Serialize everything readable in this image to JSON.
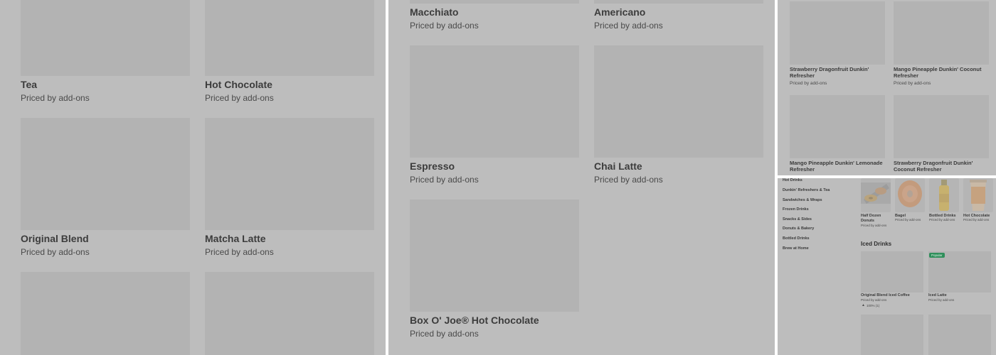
{
  "panel_a": {
    "items": [
      {
        "name": "Tea",
        "price": "Priced by add-ons"
      },
      {
        "name": "Hot Chocolate",
        "price": "Priced by add-ons"
      },
      {
        "name": "Original Blend",
        "price": "Priced by add-ons"
      },
      {
        "name": "Matcha Latte",
        "price": "Priced by add-ons"
      }
    ]
  },
  "panel_b": {
    "items": [
      {
        "name": "Macchiato",
        "price": "Priced by add-ons"
      },
      {
        "name": "Americano",
        "price": "Priced by add-ons"
      },
      {
        "name": "Espresso",
        "price": "Priced by add-ons"
      },
      {
        "name": "Chai Latte",
        "price": "Priced by add-ons"
      },
      {
        "name": "Box O' Joe® Hot Chocolate",
        "price": "Priced by add-ons"
      }
    ]
  },
  "panel_c": {
    "items": [
      {
        "name": "Strawberry Dragonfruit Dunkin' Refresher",
        "price": "Priced by add-ons"
      },
      {
        "name": "Mango Pineapple Dunkin' Coconut Refresher",
        "price": "Priced by add-ons"
      },
      {
        "name": "Mango Pineapple Dunkin' Lemonade Refresher",
        "price": ""
      },
      {
        "name": "Strawberry Dragonfruit Dunkin' Coconut Refresher",
        "price": ""
      }
    ]
  },
  "panel_d": {
    "nav": [
      "Hot Drinks",
      "Dunkin' Refreshers & Tea",
      "Sandwiches & Wraps",
      "Frozen Drinks",
      "Snacks & Sides",
      "Donuts & Bakery",
      "Bottled Drinks",
      "Brew at Home"
    ],
    "top_items": [
      {
        "name": "Half Dozen Donuts",
        "price": "Priced by add-ons"
      },
      {
        "name": "Bagel",
        "price": "Priced by add-ons"
      },
      {
        "name": "Bottled Drinks",
        "price": "Priced by add-ons"
      },
      {
        "name": "Hot Chocolate",
        "price": "Priced by add-ons"
      }
    ],
    "section_title": "Iced Drinks",
    "iced_items": [
      {
        "name": "Original Blend Iced Coffee",
        "price": "Priced by add-ons",
        "rating": "100% (1)"
      },
      {
        "name": "Iced Latte",
        "price": "Priced by add-ons",
        "badge": "Popular"
      }
    ],
    "icons": {
      "rating": "thumbs-up-icon"
    }
  },
  "colors": {
    "overlay": "#bdbdbd",
    "placeholder": "#b3b3b3",
    "badge": "#2f8f5b"
  }
}
